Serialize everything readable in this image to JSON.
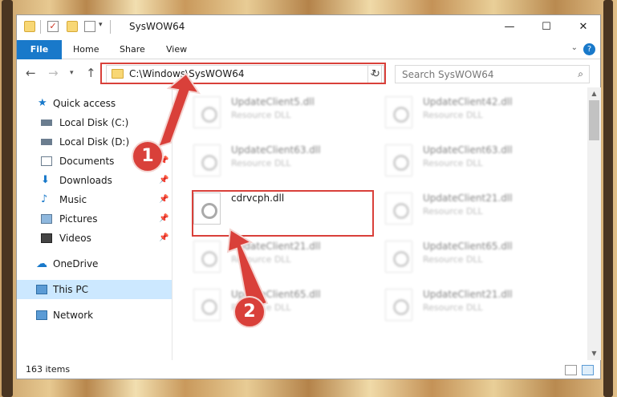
{
  "window": {
    "title": "SysWOW64",
    "minimize_glyph": "—",
    "maximize_glyph": "☐",
    "close_glyph": "✕"
  },
  "ribbon": {
    "tabs": [
      "File",
      "Home",
      "Share",
      "View"
    ],
    "help_glyph": "?"
  },
  "address_bar": {
    "path": "C:\\Windows\\SysWOW64",
    "search_placeholder": "Search SysWOW64"
  },
  "nav_pane": {
    "items": [
      {
        "label": "Quick access",
        "icon": "star-icon",
        "pinned": false
      },
      {
        "label": "Local Disk (C:)",
        "icon": "drive-icon",
        "pinned": false
      },
      {
        "label": "Local Disk (D:)",
        "icon": "drive-icon",
        "pinned": false
      },
      {
        "label": "Documents",
        "icon": "documents-icon",
        "pinned": true
      },
      {
        "label": "Downloads",
        "icon": "download-icon",
        "pinned": true
      },
      {
        "label": "Music",
        "icon": "music-icon",
        "pinned": true
      },
      {
        "label": "Pictures",
        "icon": "pictures-icon",
        "pinned": true
      },
      {
        "label": "Videos",
        "icon": "videos-icon",
        "pinned": true
      },
      {
        "label": "OneDrive",
        "icon": "cloud-icon",
        "pinned": false
      },
      {
        "label": "This PC",
        "icon": "computer-icon",
        "pinned": false,
        "selected": true
      },
      {
        "label": "Network",
        "icon": "network-icon",
        "pinned": false
      }
    ]
  },
  "files": [
    {
      "name": "UpdateClient5.dll",
      "type": "Resource DLL",
      "blurred": true
    },
    {
      "name": "UpdateClient42.dll",
      "type": "Resource DLL",
      "blurred": true
    },
    {
      "name": "UpdateClient63.dll",
      "type": "Resource DLL",
      "blurred": true
    },
    {
      "name": "UpdateClient63.dll",
      "type": "Resource DLL",
      "blurred": true
    },
    {
      "name": "cdrvcph.dll",
      "type": "",
      "blurred": false
    },
    {
      "name": "UpdateClient21.dll",
      "type": "Resource DLL",
      "blurred": true
    },
    {
      "name": "UpdateClient21.dll",
      "type": "Resource DLL",
      "blurred": true
    },
    {
      "name": "UpdateClient65.dll",
      "type": "Resource DLL",
      "blurred": true
    },
    {
      "name": "UpdateClient65.dll",
      "type": "Resource DLL",
      "blurred": true
    },
    {
      "name": "UpdateClient21.dll",
      "type": "Resource DLL",
      "blurred": true
    }
  ],
  "status_bar": {
    "item_count": "163 items"
  },
  "callouts": [
    "1",
    "2"
  ],
  "colors": {
    "accent": "#1979ca",
    "highlight": "#d9403a",
    "selected_nav": "#cce8ff"
  }
}
